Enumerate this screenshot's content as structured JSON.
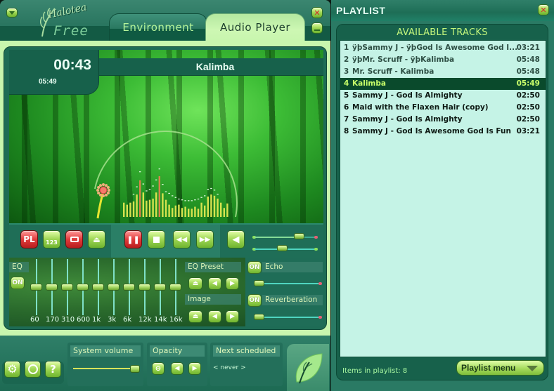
{
  "app": {
    "brand_script": "Halotea",
    "brand_edition": "Free",
    "tabs": [
      {
        "label": "Environment",
        "active": false
      },
      {
        "label": "Audio Player",
        "active": true
      }
    ]
  },
  "now_playing": {
    "elapsed": "00:43",
    "total": "05:49",
    "title": "Kalimba",
    "progress_fraction": 0.123
  },
  "spectrum": {
    "bars": [
      0.35,
      0.3,
      0.35,
      0.38,
      0.55,
      0.9,
      0.6,
      0.4,
      0.42,
      0.45,
      0.6,
      1.0,
      0.58,
      0.42,
      0.3,
      0.22,
      0.28,
      0.3,
      0.22,
      0.25,
      0.2,
      0.2,
      0.25,
      0.2,
      0.35,
      0.28,
      0.5,
      0.55,
      0.52,
      0.45,
      0.35,
      0.22,
      0.33
    ],
    "peaks": [
      0.0,
      0.0,
      0.0,
      0.5,
      0.68,
      1.05,
      0.75,
      0.58,
      0.62,
      0.7,
      0.85,
      1.12,
      0.74,
      0.56,
      0.52,
      0.46,
      0.42,
      0.38,
      0.36,
      0.34,
      0.34,
      0.34,
      0.36,
      0.38,
      0.42,
      0.46,
      0.62,
      0.64,
      0.6,
      0.5,
      0.0,
      0.0,
      0.0
    ]
  },
  "transport": {
    "playlist_label": "PL",
    "order_label": "123",
    "volume_fraction": 0.73,
    "balance_fraction": 0.45
  },
  "eq": {
    "label": "EQ",
    "on_label": "ON",
    "bands": [
      {
        "freq": "60",
        "gain": 0.5
      },
      {
        "freq": "170",
        "gain": 0.5
      },
      {
        "freq": "310",
        "gain": 0.5
      },
      {
        "freq": "600",
        "gain": 0.5
      },
      {
        "freq": "1k",
        "gain": 0.5
      },
      {
        "freq": "3k",
        "gain": 0.5
      },
      {
        "freq": "6k",
        "gain": 0.5
      },
      {
        "freq": "12k",
        "gain": 0.5
      },
      {
        "freq": "14k",
        "gain": 0.5
      },
      {
        "freq": "16k",
        "gain": 0.5
      }
    ],
    "preset_label": "EQ Preset",
    "image_label": "Image"
  },
  "effects": {
    "echo": {
      "label": "Echo",
      "on_label": "ON",
      "level": 0.0
    },
    "reverb": {
      "label": "Reverberation",
      "on_label": "ON",
      "level": 0.0
    }
  },
  "bottom": {
    "system_volume_label": "System volume",
    "system_volume_fraction": 1.0,
    "opacity_label": "Opacity",
    "next_scheduled_label": "Next scheduled",
    "next_scheduled_value": "< never >"
  },
  "playlist": {
    "title": "PLAYLIST",
    "section_title": "AVAILABLE TRACKS",
    "tracks": [
      {
        "num": "1",
        "name": "ÿþSammy J - ÿþGod Is Awesome God I...",
        "duration": "03:21",
        "state": "dim"
      },
      {
        "num": "2",
        "name": "ÿþMr. Scruff - ÿþKalimba",
        "duration": "05:48",
        "state": "dim"
      },
      {
        "num": "3",
        "name": "Mr. Scruff - Kalimba",
        "duration": "05:48",
        "state": "dim"
      },
      {
        "num": "4",
        "name": "Kalimba",
        "duration": "05:49",
        "state": "active"
      },
      {
        "num": "5",
        "name": "Sammy J - God Is Almighty",
        "duration": "02:50",
        "state": "normal"
      },
      {
        "num": "6",
        "name": "Maid with the Flaxen Hair (copy)",
        "duration": "02:50",
        "state": "normal"
      },
      {
        "num": "7",
        "name": "Sammy J - God Is Almighty",
        "duration": "02:50",
        "state": "normal"
      },
      {
        "num": "8",
        "name": "Sammy J - God Is Awesome God Is Fun",
        "duration": "03:21",
        "state": "normal"
      }
    ],
    "items_count_text": "Items in playlist: 8",
    "menu_label": "Playlist menu"
  },
  "colors": {
    "accent_green": "#9ed653",
    "active_track_bg": "#0a4a2c",
    "active_track_text": "#c9ff6a",
    "list_bg": "#c5f3e6",
    "danger_red": "#e03b3b"
  }
}
